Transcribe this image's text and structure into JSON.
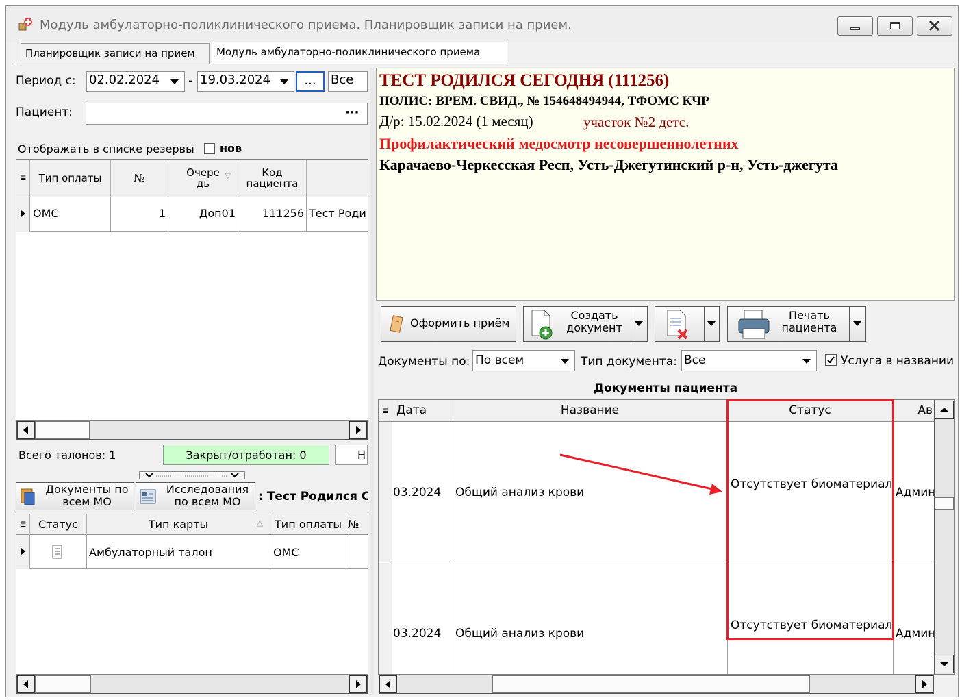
{
  "window": {
    "title": "Модуль амбулаторно-поликлинического приема. Планировщик записи на прием."
  },
  "tabs": [
    {
      "label": "Планировщик записи на прием"
    },
    {
      "label": "Модуль амбулаторно-поликлинического приема"
    }
  ],
  "filters": {
    "period_label": "Период с:",
    "date_from": "02.02.2024",
    "separator": "-",
    "date_to": "19.03.2024",
    "ellipsis": "...",
    "all_value": "Все",
    "patient_label": "Пациент:",
    "patient_value": "",
    "patient_browse": "···",
    "reserves_label": "Отображать в списке резервы",
    "new_label": "нов"
  },
  "appointments": {
    "columns": [
      "Тип оплаты",
      "№",
      "Очередь",
      "Код пациента"
    ],
    "col_queue_line1": "Очере",
    "col_queue_line2": "дь",
    "col_code_line1": "Код",
    "col_code_line2": "пациента",
    "rows": [
      {
        "payment": "ОМС",
        "number": "1",
        "queue": "Доп01",
        "code": "111256",
        "name": "Тест Роди"
      }
    ]
  },
  "summary": {
    "total": "Всего талонов: 1",
    "closed": "Закрыт/отработан: 0",
    "more": "Н"
  },
  "lower_toolbar": {
    "docs_line1": "Документы по",
    "docs_line2": "всем МО",
    "research_line1": "Исследования",
    "research_line2": "по всем МО",
    "patient_title": ": Тест Родился С"
  },
  "cards": {
    "columns": [
      "Статус",
      "Тип карты",
      "Тип оплаты",
      "№"
    ],
    "rows": [
      {
        "type": "Амбулаторный талон",
        "payment": "ОМС"
      }
    ]
  },
  "patient_info": {
    "name": "ТЕСТ РОДИЛСЯ СЕГОДНЯ (111256)",
    "policy": "ПОЛИС: ВРЕМ. СВИД., № 154648494944, ТФОМС КЧР",
    "dob": "Д/р: 15.02.2024 (1 месяц)",
    "district": "участок №2 детс.",
    "exam": "Профилактический медосмотр несовершеннолетних",
    "address": "Карачаево-Черкесская Респ, Усть-Джегутинский р-н, Усть-джегута"
  },
  "actions": {
    "accept": "Оформить приём",
    "create_line1": "Создать",
    "create_line2": "документ",
    "print_line1": "Печать",
    "print_line2": "пациента"
  },
  "doc_filters": {
    "docs_by_label": "Документы по:",
    "docs_by_value": "По всем",
    "doc_type_label": "Тип документа:",
    "doc_type_value": "Все",
    "service_label": "Услуга в названии"
  },
  "documents": {
    "title": "Документы пациента",
    "columns": [
      "Дата",
      "Название",
      "Статус",
      "Ав"
    ],
    "rows": [
      {
        "date": "03.2024",
        "name": "Общий анализ крови",
        "status": "Отсутствует биоматериал",
        "author": "Админ"
      },
      {
        "date": "03.2024",
        "name": "Общий анализ крови",
        "status": "Отсутствует биоматериал",
        "author": "Админ"
      }
    ]
  },
  "colors": {
    "highlight": "#e8202a",
    "info_bg": "#fffff0",
    "dark_red": "#8b0000",
    "closed_bg": "#ccffcc"
  }
}
